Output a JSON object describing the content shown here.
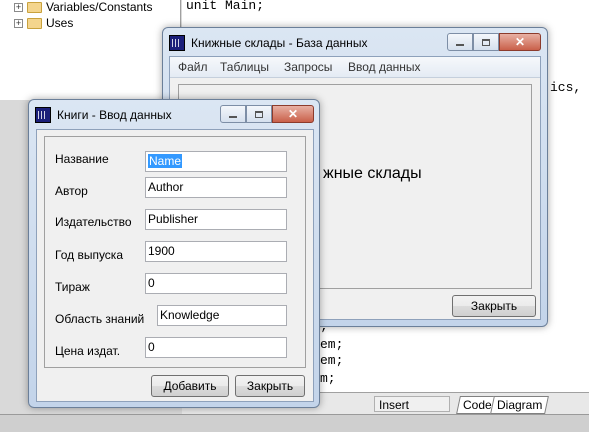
{
  "ide": {
    "tree_items": [
      "Variables/Constants",
      "Uses"
    ],
    "tree_expanders": [
      "+",
      "+"
    ],
    "code_lines": [
      "unit Main;",
      "ics, C",
      ";",
      "em;",
      "em;",
      "m;"
    ],
    "status": {
      "mode": "Insert"
    },
    "tabs": [
      "Code",
      "Diagram"
    ]
  },
  "main_window": {
    "title": "Книжные склады - База данных",
    "menu": [
      "Файл",
      "Таблицы",
      "Запросы",
      "Ввод данных"
    ],
    "heading_partial": "жные склады",
    "close_button": "Закрыть"
  },
  "books_window": {
    "title": "Книги - Ввод данных",
    "fields": [
      {
        "label": "Название",
        "value": "Name"
      },
      {
        "label": "Автор",
        "value": "Author"
      },
      {
        "label": "Издательство",
        "value": "Publisher"
      },
      {
        "label": "Год выпуска",
        "value": "1900"
      },
      {
        "label": "Тираж",
        "value": "0"
      },
      {
        "label": "Область знаний",
        "value": "Knowledge"
      },
      {
        "label": "Цена издат.",
        "value": "0"
      }
    ],
    "add_button": "Добавить",
    "close_button": "Закрыть"
  }
}
